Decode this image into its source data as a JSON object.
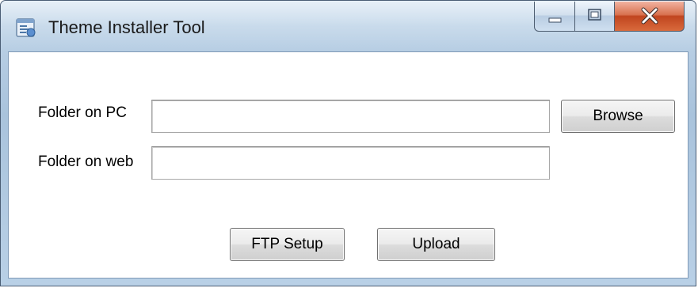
{
  "window": {
    "title": "Theme Installer Tool",
    "icon": "app-installer-icon",
    "caption_buttons": [
      "minimize-icon",
      "maximize-icon",
      "close-icon"
    ]
  },
  "form": {
    "pc_folder_label": "Folder on PC",
    "pc_folder_value": "",
    "web_folder_label": "Folder on web",
    "web_folder_value": "",
    "browse_label": "Browse"
  },
  "actions": {
    "ftp_setup_label": "FTP Setup",
    "upload_label": "Upload"
  }
}
